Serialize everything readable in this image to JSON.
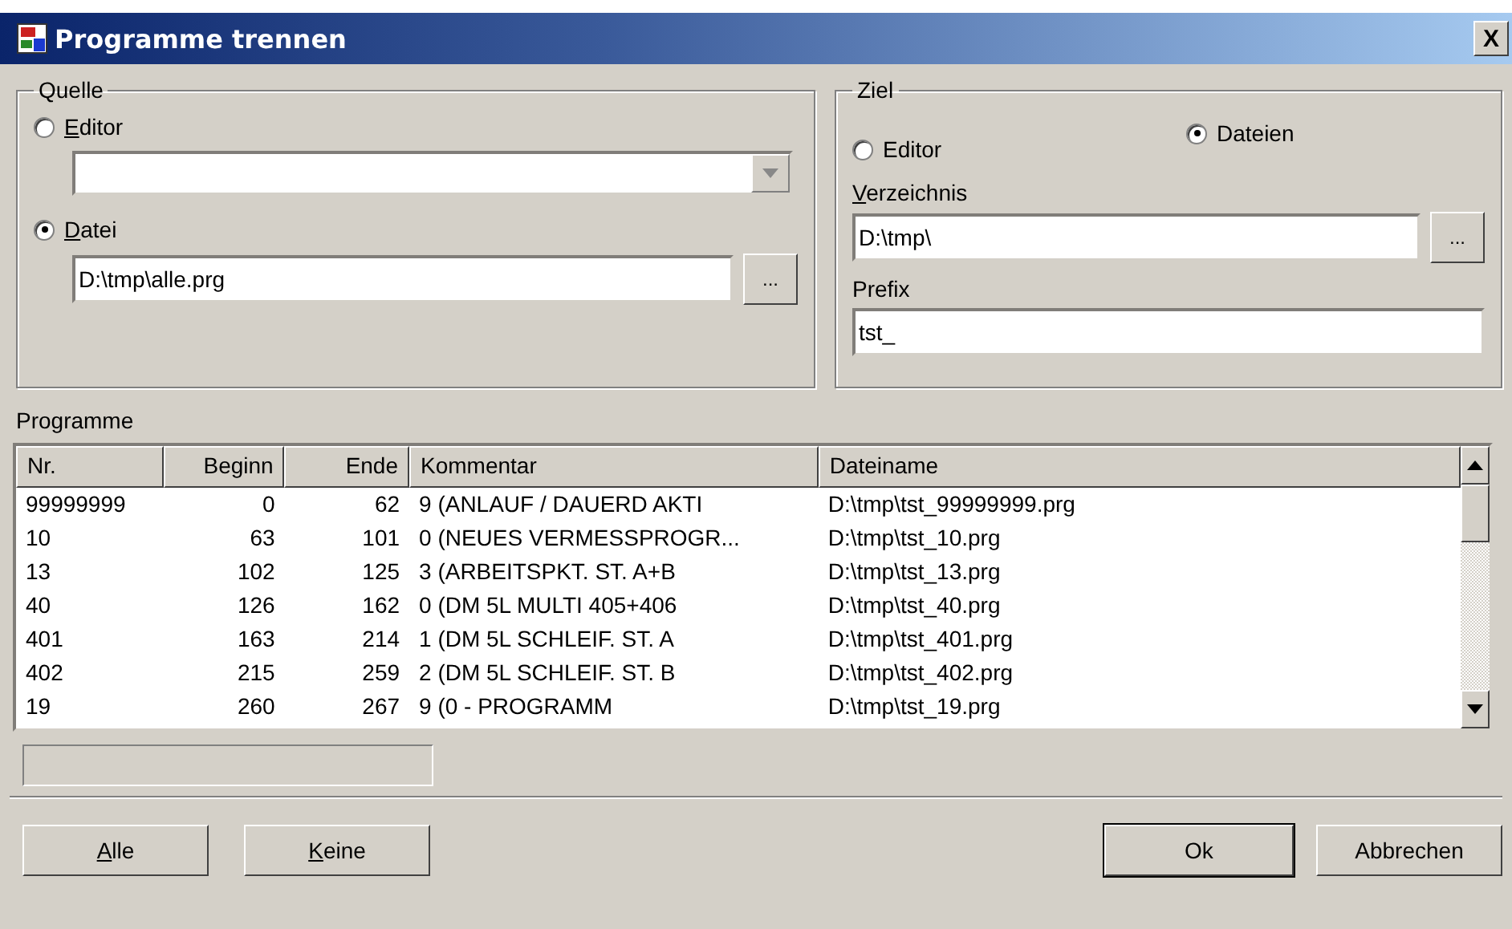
{
  "window": {
    "title": "Programme trennen",
    "close": "X"
  },
  "source": {
    "title": "Quelle",
    "options": [
      {
        "label": "Editor",
        "mnemonic": true,
        "selected": false
      },
      {
        "label": "Datei",
        "mnemonic": true,
        "selected": true
      }
    ],
    "file": {
      "value": "D:\\tmp\\alle.prg",
      "browse": "..."
    }
  },
  "target": {
    "title": "Ziel",
    "options": [
      {
        "label": "Editor",
        "mnemonic": false,
        "selected": false
      },
      {
        "label": "Dateien",
        "mnemonic": false,
        "selected": true
      }
    ],
    "directory": {
      "label": "Verzeichnis",
      "mnemonic": true,
      "value": "D:\\tmp\\",
      "browse": "..."
    },
    "prefix": {
      "label": "Prefix",
      "mnemonic": false,
      "value": "tst_"
    }
  },
  "programs": {
    "label": "Programme",
    "columns": [
      "Nr.",
      "Beginn",
      "Ende",
      "Kommentar",
      "Dateiname"
    ],
    "rows": [
      [
        "99999999",
        "0",
        "62",
        "9 (ANLAUF / DAUERD AKTI",
        "D:\\tmp\\tst_99999999.prg"
      ],
      [
        "10",
        "63",
        "101",
        "0 (NEUES VERMESSPROGR...",
        "D:\\tmp\\tst_10.prg"
      ],
      [
        "13",
        "102",
        "125",
        "3 (ARBEITSPKT. ST. A+B",
        "D:\\tmp\\tst_13.prg"
      ],
      [
        "40",
        "126",
        "162",
        "0 (DM 5L MULTI 405+406",
        "D:\\tmp\\tst_40.prg"
      ],
      [
        "401",
        "163",
        "214",
        "1 (DM 5L SCHLEIF. ST. A",
        "D:\\tmp\\tst_401.prg"
      ],
      [
        "402",
        "215",
        "259",
        "2 (DM 5L SCHLEIF. ST. B",
        "D:\\tmp\\tst_402.prg"
      ],
      [
        "19",
        "260",
        "267",
        "9 (0 - PROGRAMM",
        "D:\\tmp\\tst_19.prg"
      ]
    ]
  },
  "buttons": [
    {
      "label": "Alle",
      "mnemonic": true,
      "default": false
    },
    {
      "label": "Keine",
      "mnemonic": true,
      "default": false
    },
    {
      "label": "Ok",
      "mnemonic": false,
      "default": true
    },
    {
      "label": "Abbrechen",
      "mnemonic": false,
      "default": false
    }
  ]
}
